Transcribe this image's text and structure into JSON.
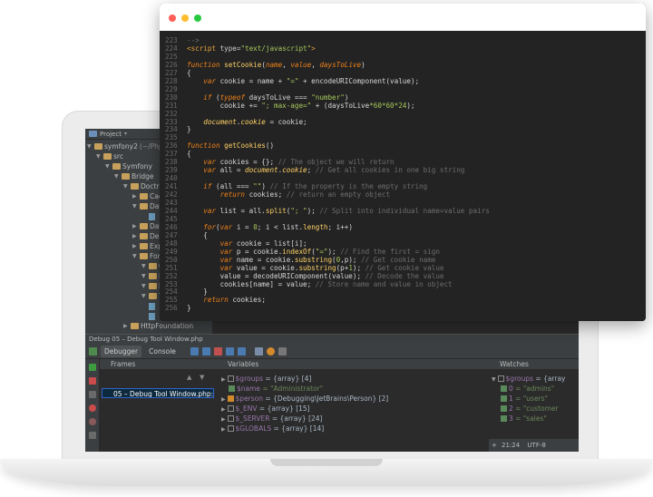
{
  "colors": {
    "window_dot_close": "#ff5f57",
    "window_dot_minimize": "#febc2e",
    "window_dot_maximize": "#28c840",
    "code_bg": "#232323",
    "keyword": "#f0821a",
    "string": "#a6c95b",
    "comment": "#6d6d6d"
  },
  "ide": {
    "project_tab": "Project",
    "tree": [
      {
        "label": "symfony2",
        "path_hint": "(~/Phpsto",
        "depth": 0,
        "icon": "folder-icon"
      },
      {
        "label": "src",
        "depth": 1,
        "icon": "folder-icon"
      },
      {
        "label": "Symfony",
        "depth": 2,
        "icon": "folder-icon"
      },
      {
        "label": "Bridge",
        "depth": 3,
        "icon": "folder-icon"
      },
      {
        "label": "Doctrin",
        "depth": 4,
        "icon": "folder-icon"
      },
      {
        "label": "Cach",
        "depth": 5,
        "icon": "folder-icon"
      },
      {
        "label": "Data",
        "depth": 5,
        "icon": "folder-icon"
      },
      {
        "label": "",
        "depth": 6,
        "icon": "file-icon"
      },
      {
        "label": "Data",
        "depth": 5,
        "icon": "folder-icon"
      },
      {
        "label": "Dep",
        "depth": 5,
        "icon": "folder-icon"
      },
      {
        "label": "Expr",
        "depth": 5,
        "icon": "folder-icon"
      },
      {
        "label": "Form",
        "depth": 5,
        "icon": "folder-icon"
      },
      {
        "label": "C",
        "depth": 6,
        "icon": "folder-icon"
      },
      {
        "label": "E",
        "depth": 6,
        "icon": "folder-icon"
      },
      {
        "label": "E",
        "depth": 6,
        "icon": "folder-icon"
      },
      {
        "label": "T",
        "depth": 6,
        "icon": "folder-icon"
      },
      {
        "label": "",
        "depth": 6,
        "icon": "file-icon"
      },
      {
        "label": "",
        "depth": 6,
        "icon": "file-icon"
      },
      {
        "label": "HttpFoundation",
        "depth": 4,
        "icon": "folder-icon"
      }
    ],
    "debug_title": "Debug   05 – Debug Tool Window.php",
    "tabs": {
      "debugger": "Debugger",
      "console": "Console"
    },
    "frames_header": "Frames",
    "frame_selected": "05 – Debug Tool Window.php:23",
    "variables_header": "Variables",
    "variables": [
      {
        "name": "$groups",
        "value": "= {array} [4]",
        "expanded": false
      },
      {
        "name": "$name",
        "value": "= \"Administrator\"",
        "expanded": false
      },
      {
        "name": "$person",
        "value": "= {Debugging\\JetBrains\\Person} [2]",
        "expanded": false
      },
      {
        "name": "$_ENV",
        "value": "= {array} [15]",
        "expanded": false
      },
      {
        "name": "$_SERVER",
        "value": "= {array} [24]",
        "expanded": false
      },
      {
        "name": "$GLOBALS",
        "value": "= {array} [14]",
        "expanded": false
      }
    ],
    "watches_header": "Watches",
    "watches": [
      {
        "name": "$groups",
        "value": "= {array"
      },
      {
        "name": "0",
        "value": "= \"admins\""
      },
      {
        "name": "1",
        "value": "= \"users\""
      },
      {
        "name": "2",
        "value": "= \"customer"
      },
      {
        "name": "3",
        "value": "= \"sales\""
      }
    ],
    "status": {
      "position": "21:24",
      "encoding": "UTF-8"
    }
  },
  "code": {
    "lines": [
      {
        "n": "223",
        "segs": [
          [
            "cm",
            "-->"
          ]
        ]
      },
      {
        "n": "224",
        "segs": [
          [
            "tag",
            "<script "
          ],
          [
            "attr",
            "type="
          ],
          [
            "str",
            "\"text/javascript\""
          ],
          [
            "tag",
            ">"
          ]
        ]
      },
      {
        "n": "225",
        "segs": []
      },
      {
        "n": "226",
        "segs": [
          [
            "kw",
            "function "
          ],
          [
            "fn",
            "setCookie"
          ],
          [
            "d",
            "("
          ],
          [
            "par",
            "name"
          ],
          [
            "d",
            ", "
          ],
          [
            "par",
            "value"
          ],
          [
            "d",
            ", "
          ],
          [
            "par",
            "daysToLive"
          ],
          [
            "d",
            ")"
          ]
        ]
      },
      {
        "n": "227",
        "segs": [
          [
            "d",
            "{"
          ]
        ]
      },
      {
        "n": "228",
        "segs": [
          [
            "d",
            "    "
          ],
          [
            "kw",
            "var "
          ],
          [
            "d",
            "cookie = name + "
          ],
          [
            "str",
            "\"=\""
          ],
          [
            "d",
            " + encodeURIComponent(value);"
          ]
        ]
      },
      {
        "n": "229",
        "segs": []
      },
      {
        "n": "230",
        "segs": [
          [
            "d",
            "    "
          ],
          [
            "kw",
            "if "
          ],
          [
            "d",
            "("
          ],
          [
            "kw",
            "typeof "
          ],
          [
            "d",
            "daysToLive === "
          ],
          [
            "str",
            "\"number\""
          ],
          [
            "d",
            ")"
          ]
        ]
      },
      {
        "n": "231",
        "segs": [
          [
            "d",
            "        cookie += "
          ],
          [
            "str",
            "\"; max-age=\""
          ],
          [
            "d",
            " + (daysToLive"
          ],
          [
            "str",
            "*60*60*24"
          ],
          [
            "d",
            ");"
          ]
        ]
      },
      {
        "n": "232",
        "segs": []
      },
      {
        "n": "233",
        "segs": [
          [
            "d",
            "    "
          ],
          [
            "doc",
            "document"
          ],
          [
            "d",
            "."
          ],
          [
            "doc",
            "cookie"
          ],
          [
            "d",
            " = cookie;"
          ]
        ]
      },
      {
        "n": "234",
        "segs": [
          [
            "d",
            "}"
          ]
        ]
      },
      {
        "n": "235",
        "segs": []
      },
      {
        "n": "236",
        "segs": [
          [
            "kw",
            "function "
          ],
          [
            "fn",
            "getCookies"
          ],
          [
            "d",
            "()"
          ]
        ]
      },
      {
        "n": "237",
        "segs": [
          [
            "d",
            "{"
          ]
        ]
      },
      {
        "n": "238",
        "segs": [
          [
            "d",
            "    "
          ],
          [
            "kw",
            "var "
          ],
          [
            "d",
            "cookies = {}; "
          ],
          [
            "cm",
            "// The object we will return"
          ]
        ]
      },
      {
        "n": "239",
        "segs": [
          [
            "d",
            "    "
          ],
          [
            "kw",
            "var "
          ],
          [
            "d",
            "all = "
          ],
          [
            "doc",
            "document"
          ],
          [
            "d",
            "."
          ],
          [
            "doc",
            "cookie"
          ],
          [
            "d",
            "; "
          ],
          [
            "cm",
            "// Get all cookies in one big string"
          ]
        ]
      },
      {
        "n": "240",
        "segs": []
      },
      {
        "n": "241",
        "segs": [
          [
            "d",
            "    "
          ],
          [
            "kw",
            "if "
          ],
          [
            "d",
            "(all === "
          ],
          [
            "str",
            "\"\""
          ],
          [
            "d",
            ") "
          ],
          [
            "cm",
            "// If the property is the empty string"
          ]
        ]
      },
      {
        "n": "242",
        "segs": [
          [
            "d",
            "        "
          ],
          [
            "kw",
            "return "
          ],
          [
            "d",
            "cookies; "
          ],
          [
            "cm",
            "// return an empty object"
          ]
        ]
      },
      {
        "n": "243",
        "segs": []
      },
      {
        "n": "244",
        "segs": [
          [
            "d",
            "    "
          ],
          [
            "kw",
            "var "
          ],
          [
            "d",
            "list = all."
          ],
          [
            "fn",
            "split"
          ],
          [
            "d",
            "("
          ],
          [
            "str",
            "\"; \""
          ],
          [
            "d",
            "); "
          ],
          [
            "cm",
            "// Split into individual name=value pairs"
          ]
        ]
      },
      {
        "n": "245",
        "segs": []
      },
      {
        "n": "246",
        "segs": [
          [
            "d",
            "    "
          ],
          [
            "kw",
            "for"
          ],
          [
            "d",
            "("
          ],
          [
            "kw",
            "var "
          ],
          [
            "d",
            "i = "
          ],
          [
            "str",
            "0"
          ],
          [
            "d",
            "; i < list."
          ],
          [
            "fn",
            "length"
          ],
          [
            "d",
            "; i++)"
          ]
        ]
      },
      {
        "n": "247",
        "segs": [
          [
            "d",
            "    {"
          ]
        ]
      },
      {
        "n": "248",
        "segs": [
          [
            "d",
            "        "
          ],
          [
            "kw",
            "var "
          ],
          [
            "d",
            "cookie = list[i];"
          ]
        ]
      },
      {
        "n": "249",
        "segs": [
          [
            "d",
            "        "
          ],
          [
            "kw",
            "var "
          ],
          [
            "d",
            "p = cookie."
          ],
          [
            "fn",
            "indexOf"
          ],
          [
            "d",
            "("
          ],
          [
            "str",
            "\"=\""
          ],
          [
            "d",
            "); "
          ],
          [
            "cm",
            "// Find the first = sign"
          ]
        ]
      },
      {
        "n": "250",
        "segs": [
          [
            "d",
            "        "
          ],
          [
            "kw",
            "var "
          ],
          [
            "d",
            "name = cookie."
          ],
          [
            "fn",
            "substring"
          ],
          [
            "d",
            "("
          ],
          [
            "str",
            "0"
          ],
          [
            "d",
            ",p); "
          ],
          [
            "cm",
            "// Get cookie name"
          ]
        ]
      },
      {
        "n": "251",
        "segs": [
          [
            "d",
            "        "
          ],
          [
            "kw",
            "var "
          ],
          [
            "d",
            "value = cookie."
          ],
          [
            "fn",
            "substring"
          ],
          [
            "d",
            "(p+"
          ],
          [
            "str",
            "1"
          ],
          [
            "d",
            "); "
          ],
          [
            "cm",
            "// Get cookie value"
          ]
        ]
      },
      {
        "n": "252",
        "segs": [
          [
            "d",
            "        value = decodeURIComponent(value); "
          ],
          [
            "cm",
            "// Decode the value"
          ]
        ]
      },
      {
        "n": "253",
        "segs": [
          [
            "d",
            "        cookies[name] = value; "
          ],
          [
            "cm",
            "// Store name and value in object"
          ]
        ]
      },
      {
        "n": "254",
        "segs": [
          [
            "d",
            "    }"
          ]
        ]
      },
      {
        "n": "255",
        "segs": [
          [
            "d",
            "    "
          ],
          [
            "kw",
            "return "
          ],
          [
            "d",
            "cookies;"
          ]
        ]
      },
      {
        "n": "256",
        "segs": [
          [
            "d",
            "}"
          ]
        ]
      }
    ]
  }
}
